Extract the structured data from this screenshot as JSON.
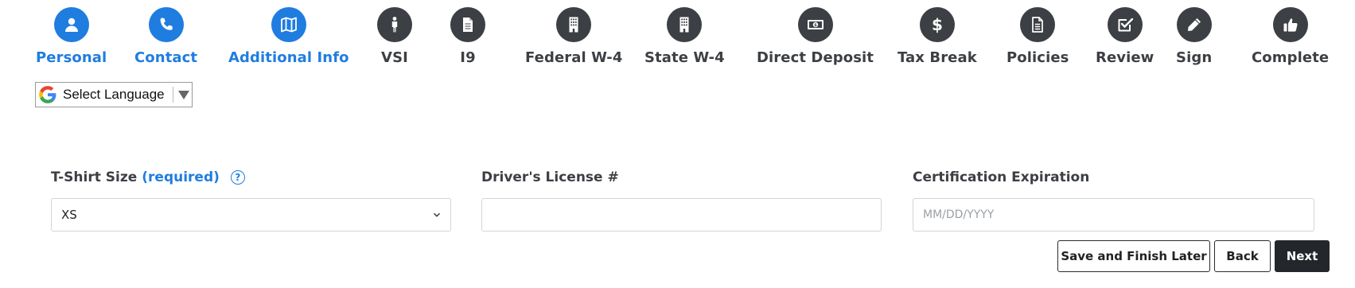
{
  "steps": [
    {
      "label": "Personal",
      "icon": "user-icon",
      "state": "active"
    },
    {
      "label": "Contact",
      "icon": "phone-icon",
      "state": "active"
    },
    {
      "label": "Additional Info",
      "icon": "map-icon",
      "state": "active"
    },
    {
      "label": "VSI",
      "icon": "person-icon",
      "state": "inactive"
    },
    {
      "label": "I9",
      "icon": "document-icon",
      "state": "inactive"
    },
    {
      "label": "Federal W-4",
      "icon": "building-icon",
      "state": "inactive"
    },
    {
      "label": "State W-4",
      "icon": "building-icon",
      "state": "inactive"
    },
    {
      "label": "Direct Deposit",
      "icon": "money-icon",
      "state": "inactive"
    },
    {
      "label": "Tax Break",
      "icon": "dollar-icon",
      "state": "inactive"
    },
    {
      "label": "Policies",
      "icon": "document-lines-icon",
      "state": "inactive"
    },
    {
      "label": "Review",
      "icon": "check-square-icon",
      "state": "inactive"
    },
    {
      "label": "Sign",
      "icon": "pencil-icon",
      "state": "inactive"
    },
    {
      "label": "Complete",
      "icon": "thumbs-up-icon",
      "state": "inactive"
    }
  ],
  "colors": {
    "active": "#1f7de0",
    "inactive": "#3c3f43",
    "primary_button": "#23272b"
  },
  "language": {
    "label": "Select Language",
    "icon": "google-g-icon"
  },
  "form": {
    "tshirt": {
      "label": "T-Shirt Size",
      "required": "(required)",
      "help": "?",
      "value": "XS"
    },
    "license": {
      "label": "Driver's License #",
      "value": "",
      "placeholder": ""
    },
    "cert": {
      "label": "Certification Expiration",
      "value": "",
      "placeholder": "MM/DD/YYYY"
    }
  },
  "buttons": {
    "save_later": "Save and Finish Later",
    "back": "Back",
    "next": "Next"
  }
}
